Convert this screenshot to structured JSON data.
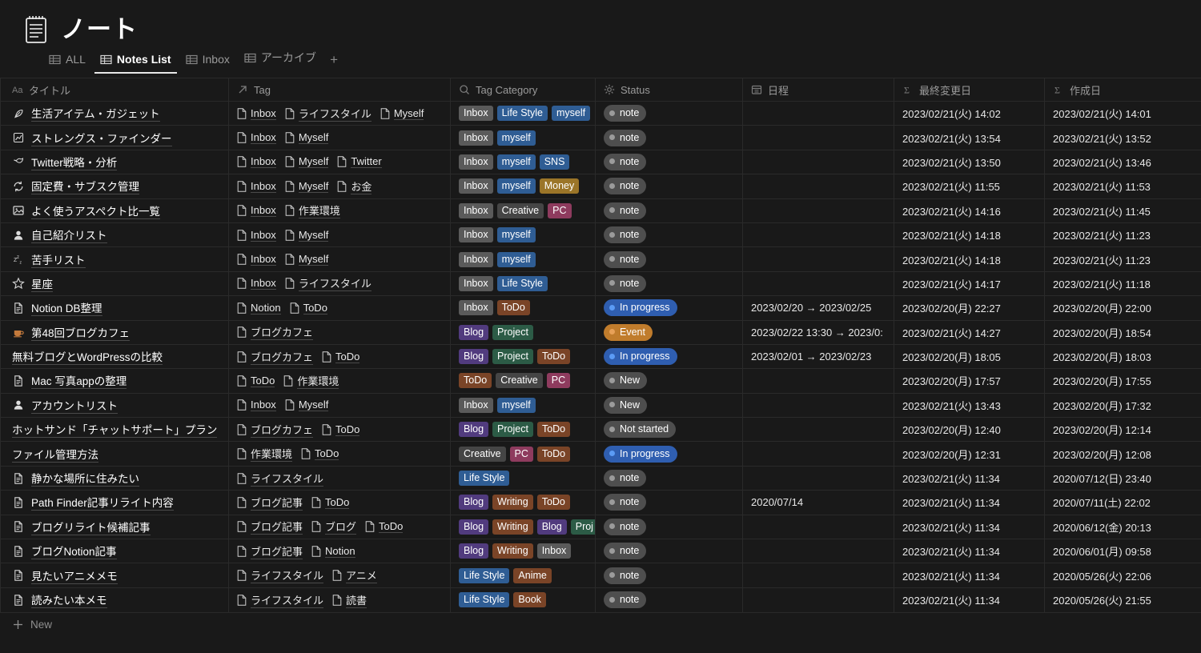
{
  "header": {
    "title": "ノート",
    "icon": "notepad-icon"
  },
  "tabs": [
    {
      "label": "ALL",
      "icon": "table-icon",
      "active": false
    },
    {
      "label": "Notes List",
      "icon": "table-icon",
      "active": true
    },
    {
      "label": "Inbox",
      "icon": "table-icon",
      "active": false
    },
    {
      "label": "アーカイブ",
      "icon": "table-icon",
      "active": false
    }
  ],
  "tab_add_label": "+",
  "columns": [
    {
      "label": "タイトル",
      "icon": "title-aa-icon",
      "key": "title"
    },
    {
      "label": "Tag",
      "icon": "relation-arrow-icon",
      "key": "tag"
    },
    {
      "label": "Tag Category",
      "icon": "rollup-search-icon",
      "key": "category"
    },
    {
      "label": "Status",
      "icon": "status-sparkle-icon",
      "key": "status"
    },
    {
      "label": "日程",
      "icon": "date-calendar-icon",
      "key": "schedule"
    },
    {
      "label": "最終変更日",
      "icon": "formula-sigma-icon",
      "key": "modified"
    },
    {
      "label": "作成日",
      "icon": "formula-sigma-icon",
      "key": "created"
    }
  ],
  "colors": {
    "pill_gray": "#5a5a5a",
    "pill_dark_gray": "#454545",
    "pill_blue": "#2f5d94",
    "pill_purple": "#513b7e",
    "pill_green": "#2c5b46",
    "pill_brown": "#7a4427",
    "pill_yellow": "#9b7528",
    "pill_pink": "#8e3b5e",
    "status_gray": "#4e4e4e",
    "status_blue": "#2f5eb0",
    "status_orange": "#c07c2c",
    "status_dot_gray": "#9b9b9b",
    "status_dot_blue": "#5b9bf5",
    "status_dot_orange": "#e8a158",
    "background": "#191919",
    "border": "#2a2a2a"
  },
  "rows": [
    {
      "icon": "feather-icon",
      "title": "生活アイテム・ガジェット",
      "tags": [
        "Inbox",
        "ライフスタイル",
        "Myself"
      ],
      "categories": [
        {
          "label": "Inbox",
          "color": "pill_gray"
        },
        {
          "label": "Life Style",
          "color": "pill_blue"
        },
        {
          "label": "myself",
          "color": "pill_blue"
        }
      ],
      "status": {
        "label": "note",
        "color": "status_gray",
        "dot": "status_dot_gray"
      },
      "schedule": "",
      "modified": "2023/02/21(火) 14:02",
      "created": "2023/02/21(火) 14:01"
    },
    {
      "icon": "chart-icon",
      "title": "ストレングス・ファインダー",
      "tags": [
        "Inbox",
        "Myself"
      ],
      "categories": [
        {
          "label": "Inbox",
          "color": "pill_gray"
        },
        {
          "label": "myself",
          "color": "pill_blue"
        }
      ],
      "status": {
        "label": "note",
        "color": "status_gray",
        "dot": "status_dot_gray"
      },
      "schedule": "",
      "modified": "2023/02/21(火) 13:54",
      "created": "2023/02/21(火) 13:52"
    },
    {
      "icon": "bird-icon",
      "title": "Twitter戦略・分析",
      "tags": [
        "Inbox",
        "Myself",
        "Twitter"
      ],
      "categories": [
        {
          "label": "Inbox",
          "color": "pill_gray"
        },
        {
          "label": "myself",
          "color": "pill_blue"
        },
        {
          "label": "SNS",
          "color": "pill_blue"
        }
      ],
      "status": {
        "label": "note",
        "color": "status_gray",
        "dot": "status_dot_gray"
      },
      "schedule": "",
      "modified": "2023/02/21(火) 13:50",
      "created": "2023/02/21(火) 13:46"
    },
    {
      "icon": "recycle-icon",
      "title": "固定費・サブスク管理",
      "tags": [
        "Inbox",
        "Myself",
        "お金"
      ],
      "categories": [
        {
          "label": "Inbox",
          "color": "pill_gray"
        },
        {
          "label": "myself",
          "color": "pill_blue"
        },
        {
          "label": "Money",
          "color": "pill_yellow"
        }
      ],
      "status": {
        "label": "note",
        "color": "status_gray",
        "dot": "status_dot_gray"
      },
      "schedule": "",
      "modified": "2023/02/21(火) 11:55",
      "created": "2023/02/21(火) 11:53"
    },
    {
      "icon": "picture-icon",
      "title": "よく使うアスペクト比一覧",
      "tags": [
        "Inbox",
        "作業環境"
      ],
      "categories": [
        {
          "label": "Inbox",
          "color": "pill_gray"
        },
        {
          "label": "Creative",
          "color": "pill_dark_gray"
        },
        {
          "label": "PC",
          "color": "pill_pink"
        }
      ],
      "status": {
        "label": "note",
        "color": "status_gray",
        "dot": "status_dot_gray"
      },
      "schedule": "",
      "modified": "2023/02/21(火) 14:16",
      "created": "2023/02/21(火) 11:45"
    },
    {
      "icon": "person-icon",
      "title": "自己紹介リスト",
      "tags": [
        "Inbox",
        "Myself"
      ],
      "categories": [
        {
          "label": "Inbox",
          "color": "pill_gray"
        },
        {
          "label": "myself",
          "color": "pill_blue"
        }
      ],
      "status": {
        "label": "note",
        "color": "status_gray",
        "dot": "status_dot_gray"
      },
      "schedule": "",
      "modified": "2023/02/21(火) 14:18",
      "created": "2023/02/21(火) 11:23"
    },
    {
      "icon": "sleep-zzz-icon",
      "title": "苦手リスト",
      "tags": [
        "Inbox",
        "Myself"
      ],
      "categories": [
        {
          "label": "Inbox",
          "color": "pill_gray"
        },
        {
          "label": "myself",
          "color": "pill_blue"
        }
      ],
      "status": {
        "label": "note",
        "color": "status_gray",
        "dot": "status_dot_gray"
      },
      "schedule": "",
      "modified": "2023/02/21(火) 14:18",
      "created": "2023/02/21(火) 11:23"
    },
    {
      "icon": "star-icon",
      "title": "星座",
      "tags": [
        "Inbox",
        "ライフスタイル"
      ],
      "categories": [
        {
          "label": "Inbox",
          "color": "pill_gray"
        },
        {
          "label": "Life Style",
          "color": "pill_blue"
        }
      ],
      "status": {
        "label": "note",
        "color": "status_gray",
        "dot": "status_dot_gray"
      },
      "schedule": "",
      "modified": "2023/02/21(火) 14:17",
      "created": "2023/02/21(火) 11:18"
    },
    {
      "icon": "document-icon",
      "title": "Notion DB整理",
      "tags": [
        "Notion",
        "ToDo"
      ],
      "categories": [
        {
          "label": "Inbox",
          "color": "pill_gray"
        },
        {
          "label": "ToDo",
          "color": "pill_brown"
        }
      ],
      "status": {
        "label": "In progress",
        "color": "status_blue",
        "dot": "status_dot_blue"
      },
      "schedule": "2023/02/20 → 2023/02/25",
      "modified": "2023/02/20(月) 22:27",
      "created": "2023/02/20(月) 22:00"
    },
    {
      "icon": "coffee-icon",
      "title": "第48回ブログカフェ",
      "tags": [
        "ブログカフェ"
      ],
      "categories": [
        {
          "label": "Blog",
          "color": "pill_purple"
        },
        {
          "label": "Project",
          "color": "pill_green"
        }
      ],
      "status": {
        "label": "Event",
        "color": "status_orange",
        "dot": "status_dot_orange"
      },
      "schedule": "2023/02/22 13:30 → 2023/0:",
      "modified": "2023/02/21(火) 14:27",
      "created": "2023/02/20(月) 18:54"
    },
    {
      "icon": "",
      "title": "無料ブログとWordPressの比較",
      "tags": [
        "ブログカフェ",
        "ToDo"
      ],
      "categories": [
        {
          "label": "Blog",
          "color": "pill_purple"
        },
        {
          "label": "Project",
          "color": "pill_green"
        },
        {
          "label": "ToDo",
          "color": "pill_brown"
        }
      ],
      "status": {
        "label": "In progress",
        "color": "status_blue",
        "dot": "status_dot_blue"
      },
      "schedule": "2023/02/01 → 2023/02/23",
      "modified": "2023/02/20(月) 18:05",
      "created": "2023/02/20(月) 18:03"
    },
    {
      "icon": "document-icon",
      "title": "Mac 写真appの整理",
      "tags": [
        "ToDo",
        "作業環境"
      ],
      "categories": [
        {
          "label": "ToDo",
          "color": "pill_brown"
        },
        {
          "label": "Creative",
          "color": "pill_dark_gray"
        },
        {
          "label": "PC",
          "color": "pill_pink"
        }
      ],
      "status": {
        "label": "New",
        "color": "status_gray",
        "dot": "status_dot_gray"
      },
      "schedule": "",
      "modified": "2023/02/20(月) 17:57",
      "created": "2023/02/20(月) 17:55"
    },
    {
      "icon": "person-icon",
      "title": "アカウントリスト",
      "tags": [
        "Inbox",
        "Myself"
      ],
      "categories": [
        {
          "label": "Inbox",
          "color": "pill_gray"
        },
        {
          "label": "myself",
          "color": "pill_blue"
        }
      ],
      "status": {
        "label": "New",
        "color": "status_gray",
        "dot": "status_dot_gray"
      },
      "schedule": "",
      "modified": "2023/02/21(火) 13:43",
      "created": "2023/02/20(月) 17:32"
    },
    {
      "icon": "",
      "title": "ホットサンド「チャットサポート」プラン",
      "tags": [
        "ブログカフェ",
        "ToDo"
      ],
      "categories": [
        {
          "label": "Blog",
          "color": "pill_purple"
        },
        {
          "label": "Project",
          "color": "pill_green"
        },
        {
          "label": "ToDo",
          "color": "pill_brown"
        }
      ],
      "status": {
        "label": "Not started",
        "color": "status_gray",
        "dot": "status_dot_gray"
      },
      "schedule": "",
      "modified": "2023/02/20(月) 12:40",
      "created": "2023/02/20(月) 12:14"
    },
    {
      "icon": "",
      "title": "ファイル管理方法",
      "tags": [
        "作業環境",
        "ToDo"
      ],
      "categories": [
        {
          "label": "Creative",
          "color": "pill_dark_gray"
        },
        {
          "label": "PC",
          "color": "pill_pink"
        },
        {
          "label": "ToDo",
          "color": "pill_brown"
        }
      ],
      "status": {
        "label": "In progress",
        "color": "status_blue",
        "dot": "status_dot_blue"
      },
      "schedule": "",
      "modified": "2023/02/20(月) 12:31",
      "created": "2023/02/20(月) 12:08"
    },
    {
      "icon": "document-icon",
      "title": "静かな場所に住みたい",
      "tags": [
        "ライフスタイル"
      ],
      "categories": [
        {
          "label": "Life Style",
          "color": "pill_blue"
        }
      ],
      "status": {
        "label": "note",
        "color": "status_gray",
        "dot": "status_dot_gray"
      },
      "schedule": "",
      "modified": "2023/02/21(火) 11:34",
      "created": "2020/07/12(日) 23:40"
    },
    {
      "icon": "document-icon",
      "title": "Path Finder記事リライト内容",
      "tags": [
        "ブログ記事",
        "ToDo"
      ],
      "categories": [
        {
          "label": "Blog",
          "color": "pill_purple"
        },
        {
          "label": "Writing",
          "color": "pill_brown"
        },
        {
          "label": "ToDo",
          "color": "pill_brown"
        }
      ],
      "status": {
        "label": "note",
        "color": "status_gray",
        "dot": "status_dot_gray"
      },
      "schedule": "2020/07/14",
      "modified": "2023/02/21(火) 11:34",
      "created": "2020/07/11(土) 22:02"
    },
    {
      "icon": "document-icon",
      "title": "ブログリライト候補記事",
      "tags": [
        "ブログ記事",
        "ブログ",
        "ToDo"
      ],
      "categories": [
        {
          "label": "Blog",
          "color": "pill_purple"
        },
        {
          "label": "Writing",
          "color": "pill_brown"
        },
        {
          "label": "Blog",
          "color": "pill_purple"
        },
        {
          "label": "Proj",
          "color": "pill_green"
        }
      ],
      "status": {
        "label": "note",
        "color": "status_gray",
        "dot": "status_dot_gray"
      },
      "schedule": "",
      "modified": "2023/02/21(火) 11:34",
      "created": "2020/06/12(金) 20:13"
    },
    {
      "icon": "document-icon",
      "title": "ブログNotion記事",
      "tags": [
        "ブログ記事",
        "Notion"
      ],
      "categories": [
        {
          "label": "Blog",
          "color": "pill_purple"
        },
        {
          "label": "Writing",
          "color": "pill_brown"
        },
        {
          "label": "Inbox",
          "color": "pill_gray"
        }
      ],
      "status": {
        "label": "note",
        "color": "status_gray",
        "dot": "status_dot_gray"
      },
      "schedule": "",
      "modified": "2023/02/21(火) 11:34",
      "created": "2020/06/01(月) 09:58"
    },
    {
      "icon": "document-icon",
      "title": "見たいアニメメモ",
      "tags": [
        "ライフスタイル",
        "アニメ"
      ],
      "categories": [
        {
          "label": "Life Style",
          "color": "pill_blue"
        },
        {
          "label": "Anime",
          "color": "pill_brown"
        }
      ],
      "status": {
        "label": "note",
        "color": "status_gray",
        "dot": "status_dot_gray"
      },
      "schedule": "",
      "modified": "2023/02/21(火) 11:34",
      "created": "2020/05/26(火) 22:06"
    },
    {
      "icon": "document-icon",
      "title": "読みたい本メモ",
      "tags": [
        "ライフスタイル",
        "読書"
      ],
      "categories": [
        {
          "label": "Life Style",
          "color": "pill_blue"
        },
        {
          "label": "Book",
          "color": "pill_brown"
        }
      ],
      "status": {
        "label": "note",
        "color": "status_gray",
        "dot": "status_dot_gray"
      },
      "schedule": "",
      "modified": "2023/02/21(火) 11:34",
      "created": "2020/05/26(火) 21:55"
    }
  ],
  "footer": {
    "new_label": "New",
    "icon": "plus-icon"
  }
}
